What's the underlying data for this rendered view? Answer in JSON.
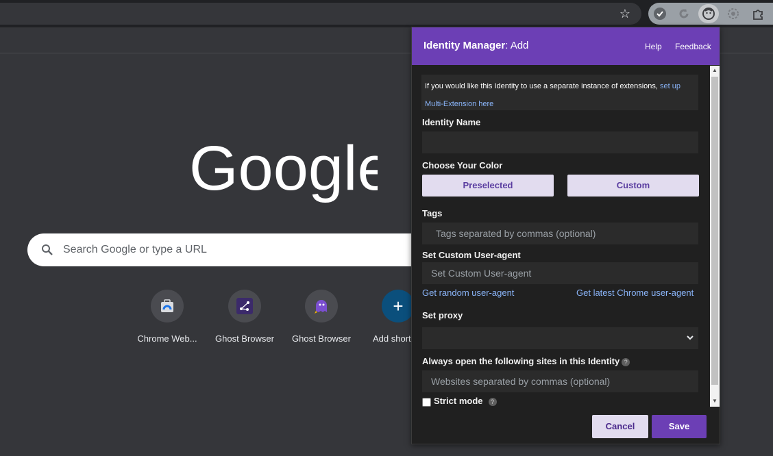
{
  "browser": {
    "bookmark_icon": "star-icon",
    "extensions": [
      "checkmark-extension-icon",
      "refresh-extension-icon",
      "ghost-identity-extension-icon",
      "settings-gear-extension-icon",
      "puzzle-extensions-icon"
    ]
  },
  "ntp": {
    "logo_text": "Google",
    "search_placeholder": "Search Google or type a URL",
    "shortcuts": [
      {
        "label": "Chrome Web...",
        "icon": "chrome-web-store-icon"
      },
      {
        "label": "Ghost Browser",
        "icon": "share-nodes-icon"
      },
      {
        "label": "Ghost Browser",
        "icon": "ghost-icon"
      },
      {
        "label": "Add short",
        "icon": "plus-icon"
      }
    ]
  },
  "popup": {
    "title_bold": "Identity Manager",
    "title_rest": ": Add",
    "help": "Help",
    "feedback": "Feedback",
    "info_text": "If you would like this Identity to use a separate instance of extensions, ",
    "info_link": "set up Multi-Extension here",
    "identity_name_label": "Identity Name",
    "identity_name_value": "",
    "color_label": "Choose Your Color",
    "preselected": "Preselected",
    "custom": "Custom",
    "tags_label": "Tags",
    "tags_placeholder": "Tags separated by commas (optional)",
    "ua_label": "Set Custom User-agent",
    "ua_placeholder": "Set Custom User-agent",
    "random_ua": "Get random user-agent",
    "latest_ua": "Get latest Chrome user-agent",
    "proxy_label": "Set proxy",
    "proxy_value": "",
    "sites_label": "Always open the following sites in this Identity",
    "sites_placeholder": "Websites separated by commas (optional)",
    "strict_label": "Strict mode",
    "help_mark": "?",
    "cancel": "Cancel",
    "save": "Save"
  },
  "colors": {
    "accent": "#6c3fb5",
    "button_light": "#e2dcef",
    "link": "#8ab4f8"
  }
}
